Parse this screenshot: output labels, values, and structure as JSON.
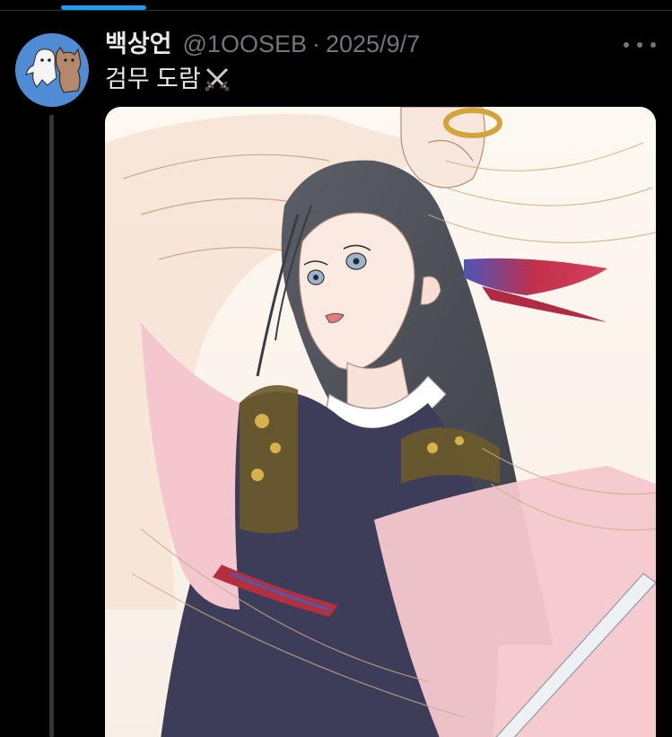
{
  "post": {
    "display_name": "백상언",
    "handle": "@1OOSEB",
    "separator": "·",
    "date": "2025/9/7",
    "text": "검무 도람",
    "emoji_icon": "crossed-swords-icon",
    "more_icon": "more-options-icon",
    "avatar_icon": "ghost-and-cat-avatar",
    "media_icon": "illustration-sword-dancer"
  },
  "colors": {
    "background": "#000000",
    "accent": "#1d9bf0",
    "text_primary": "#e7e9ea",
    "text_secondary": "#71767b",
    "avatar_bg": "#4f8cd4"
  }
}
